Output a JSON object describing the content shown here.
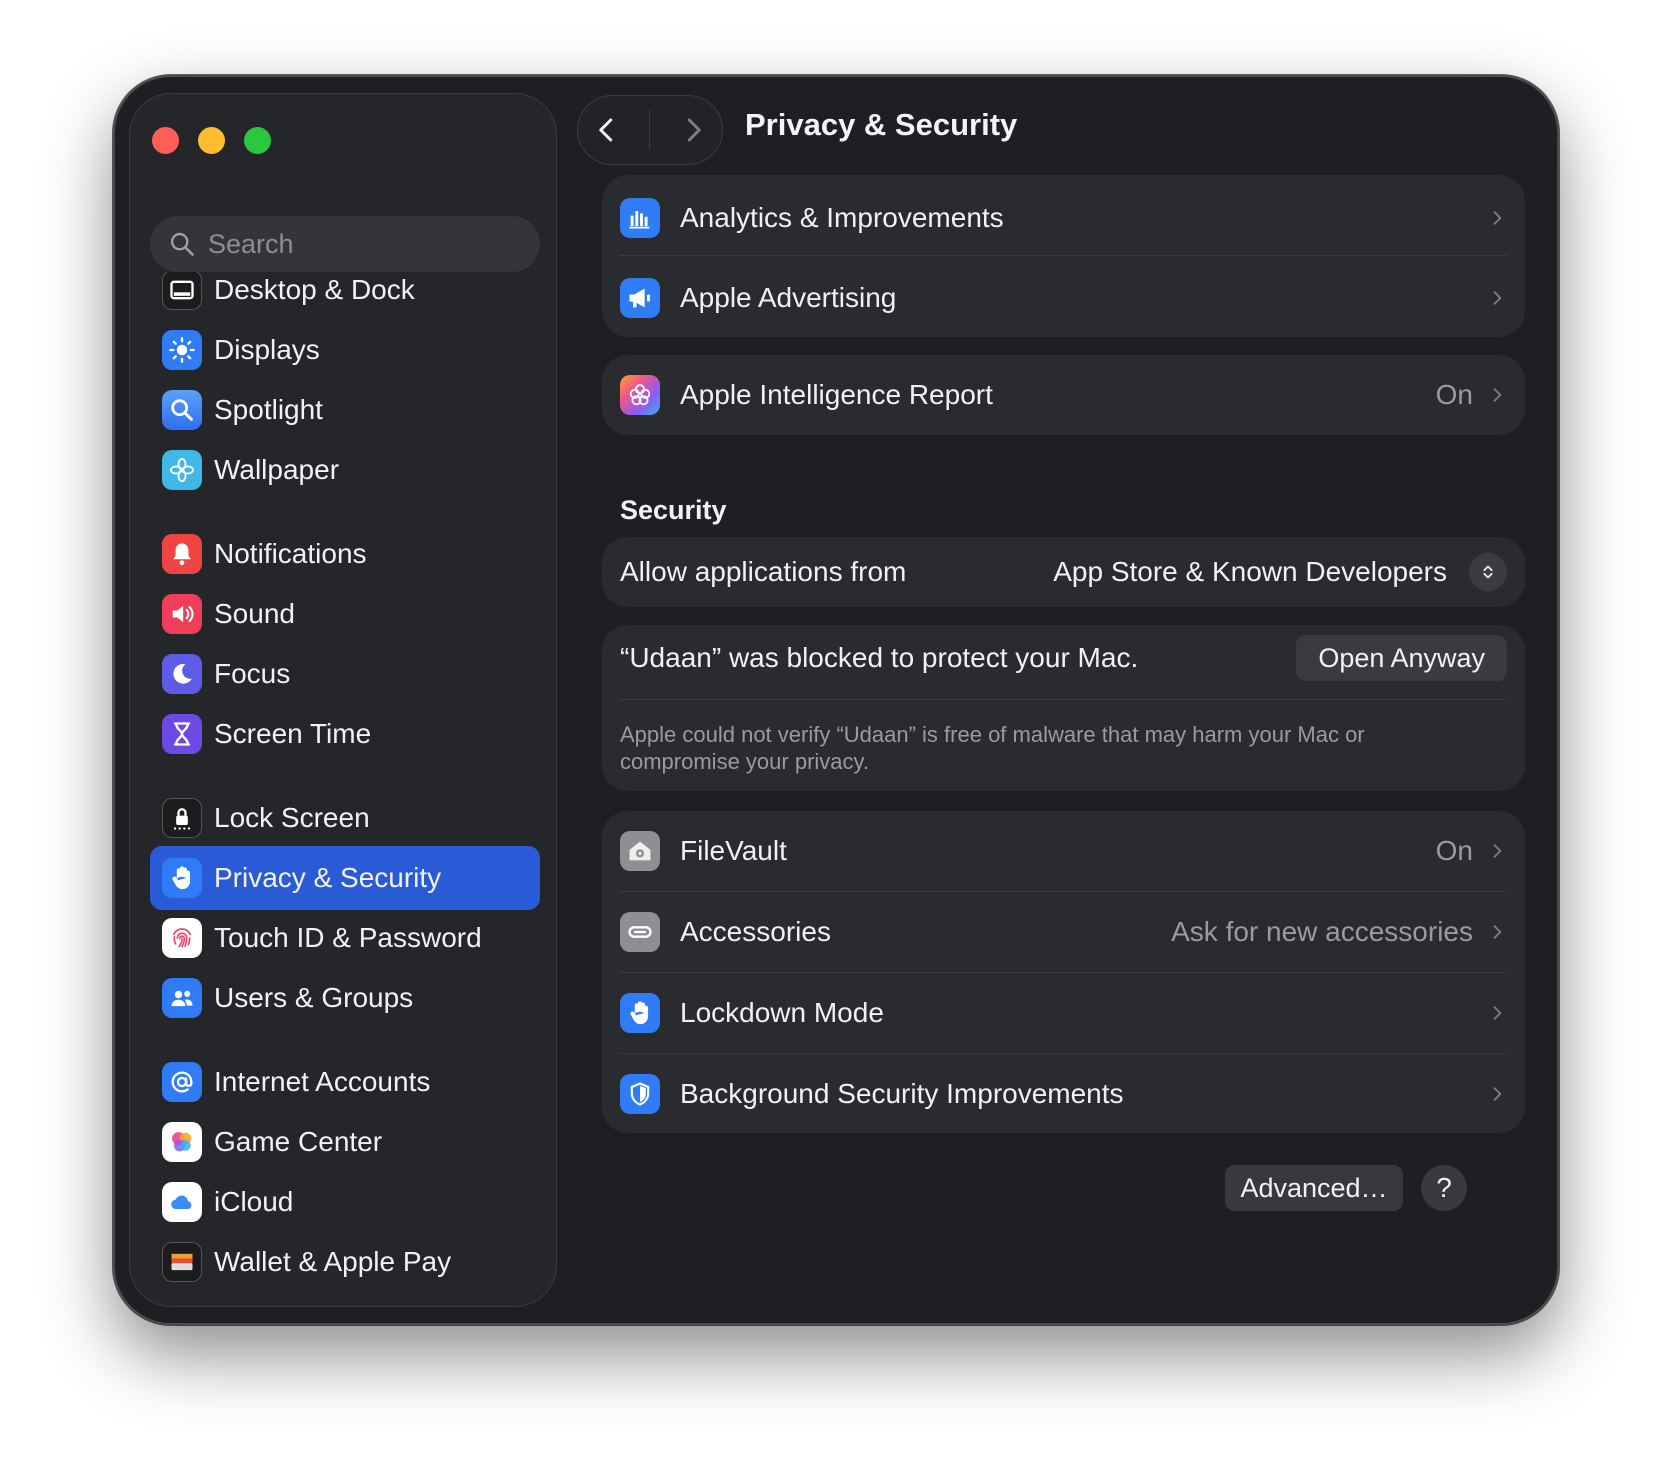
{
  "window": {
    "title": "Privacy & Security"
  },
  "sidebar": {
    "search_placeholder": "Search",
    "items": [
      {
        "label": "Desktop & Dock",
        "icon": "desktop-dock-icon",
        "color": "#1c1c1e"
      },
      {
        "label": "Displays",
        "icon": "displays-icon",
        "color": "#2f7cf6"
      },
      {
        "label": "Spotlight",
        "icon": "spotlight-icon",
        "color": "#3b82f6"
      },
      {
        "label": "Wallpaper",
        "icon": "wallpaper-icon",
        "color": "#3fb7e8"
      },
      {
        "label": "Notifications",
        "icon": "notifications-icon",
        "color": "#ef4444"
      },
      {
        "label": "Sound",
        "icon": "sound-icon",
        "color": "#ef3e5a"
      },
      {
        "label": "Focus",
        "icon": "focus-icon",
        "color": "#5e5ce6"
      },
      {
        "label": "Screen Time",
        "icon": "screen-time-icon",
        "color": "#6d4ae6"
      },
      {
        "label": "Lock Screen",
        "icon": "lock-screen-icon",
        "color": "#1c1c1e"
      },
      {
        "label": "Privacy & Security",
        "icon": "privacy-hand-icon",
        "color": "#2f7cf6",
        "active": true
      },
      {
        "label": "Touch ID & Password",
        "icon": "touch-id-icon",
        "color": "#ffffff"
      },
      {
        "label": "Users & Groups",
        "icon": "users-groups-icon",
        "color": "#2f7cf6"
      },
      {
        "label": "Internet Accounts",
        "icon": "internet-accounts-icon",
        "color": "#2f7cf6"
      },
      {
        "label": "Game Center",
        "icon": "game-center-icon",
        "color": "#ffffff"
      },
      {
        "label": "iCloud",
        "icon": "icloud-icon",
        "color": "#ffffff"
      },
      {
        "label": "Wallet & Apple Pay",
        "icon": "wallet-icon",
        "color": "#1c1c1e"
      }
    ]
  },
  "main": {
    "rows_top": [
      {
        "label": "Analytics & Improvements",
        "icon": "analytics-icon",
        "value": ""
      },
      {
        "label": "Apple Advertising",
        "icon": "advertising-icon",
        "value": ""
      }
    ],
    "intelligence": {
      "label": "Apple Intelligence Report",
      "icon": "apple-intelligence-icon",
      "value": "On"
    },
    "security_title": "Security",
    "allow_apps": {
      "label": "Allow applications from",
      "value": "App Store & Known Developers"
    },
    "blocked": {
      "message": "“Udaan” was blocked to protect your Mac.",
      "button": "Open Anyway",
      "description": "Apple could not verify “Udaan” is free of malware that may harm your Mac or compromise your privacy."
    },
    "security_rows": [
      {
        "label": "FileVault",
        "icon": "filevault-icon",
        "value": "On"
      },
      {
        "label": "Accessories",
        "icon": "accessories-icon",
        "value": "Ask for new accessories"
      },
      {
        "label": "Lockdown Mode",
        "icon": "lockdown-hand-icon",
        "value": ""
      },
      {
        "label": "Background Security Improvements",
        "icon": "shield-icon",
        "value": ""
      }
    ],
    "advanced_button": "Advanced…",
    "help_button": "?"
  }
}
